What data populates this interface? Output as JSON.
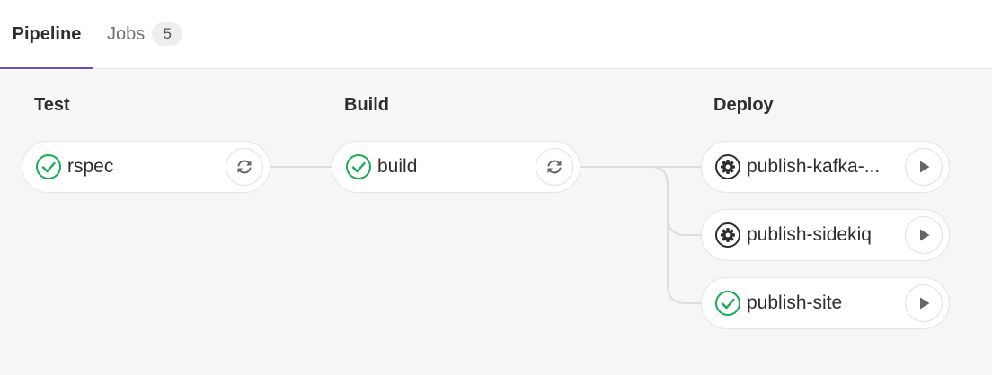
{
  "tabs": {
    "pipeline_label": "Pipeline",
    "jobs_label": "Jobs",
    "jobs_count": "5"
  },
  "stages": [
    {
      "title": "Test",
      "jobs": [
        {
          "name": "rspec",
          "status_icon": "success-check-icon",
          "action_icon": "retry-icon"
        }
      ]
    },
    {
      "title": "Build",
      "jobs": [
        {
          "name": "build",
          "status_icon": "success-check-icon",
          "action_icon": "retry-icon"
        }
      ]
    },
    {
      "title": "Deploy",
      "jobs": [
        {
          "name": "publish-kafka-...",
          "status_icon": "manual-gear-icon",
          "action_icon": "play-icon"
        },
        {
          "name": "publish-sidekiq",
          "status_icon": "manual-gear-icon",
          "action_icon": "play-icon"
        },
        {
          "name": "publish-site",
          "status_icon": "success-check-icon",
          "action_icon": "play-icon"
        }
      ]
    }
  ],
  "colors": {
    "accent": "#6b4fbb",
    "success": "#1aaa55",
    "manual": "#2e2e2e",
    "action_icon": "#666666",
    "connector": "#dddddd",
    "canvas_bg": "#f6f6f6"
  }
}
